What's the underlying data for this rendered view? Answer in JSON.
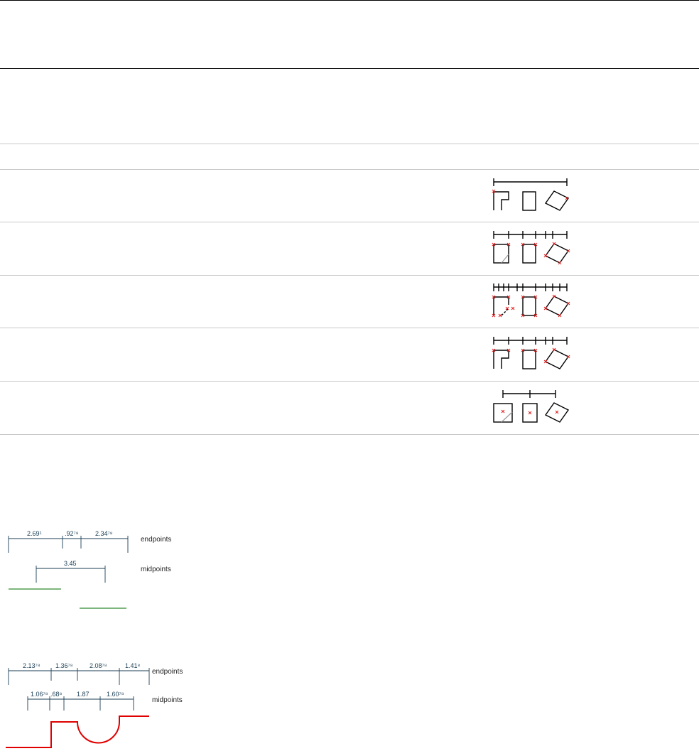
{
  "table": {
    "rows": [
      {
        "name": "row-1-icon"
      },
      {
        "name": "row-2-icon"
      },
      {
        "name": "row-3-icon"
      },
      {
        "name": "row-4-icon"
      },
      {
        "name": "row-5-icon"
      }
    ]
  },
  "diagram1": {
    "dims": [
      "2.69¹",
      ".92⁷⁸",
      "2.34⁷⁸"
    ],
    "mid_dim": "3.45",
    "label_endpoints": "endpoints",
    "label_midpoints": "midpoints"
  },
  "diagram2": {
    "dims": [
      "2.13⁷⁸",
      "1.36⁷⁸",
      "2.08⁷⁸",
      "1.41⁸"
    ],
    "mid_dims": [
      "1.06⁷⁸",
      ".68⁸",
      "1.87",
      "1.60⁷⁸"
    ],
    "label_endpoints": "endpoints",
    "label_midpoints": "midpoints"
  },
  "colors": {
    "marker": "#e02020",
    "dimension": "#1a3d55",
    "green_line": "#2e8b2e",
    "red_path": "#e00000"
  }
}
